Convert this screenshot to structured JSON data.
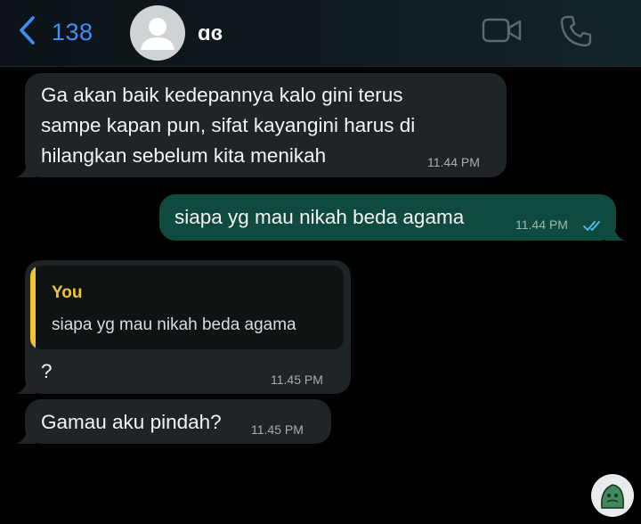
{
  "header": {
    "back_count": "138",
    "contact_name": "ɑɞ",
    "icons": [
      "chevron-left-icon",
      "video-icon",
      "phone-icon"
    ]
  },
  "messages": [
    {
      "direction": "incoming",
      "text": "Ga akan baik kedepannya kalo gini terus\nsampe kapan pun, sifat kayangini harus di\nhilangkan sebelum kita menikah",
      "time": "11.44 PM"
    },
    {
      "direction": "outgoing",
      "text": "siapa yg mau nikah beda agama",
      "time": "11.44 PM",
      "status": "read"
    },
    {
      "direction": "incoming",
      "quote": {
        "author": "You",
        "text": "siapa yg mau nikah beda agama"
      },
      "text": "?",
      "time": "11.45 PM"
    },
    {
      "direction": "incoming",
      "text": "Gamau aku pindah?",
      "time": "11.45 PM"
    }
  ],
  "colors": {
    "accent": "#3d8ff7",
    "incoming_bubble": "#1f2426",
    "outgoing_bubble": "#0f4a3e",
    "quote_bar": "#f1c232",
    "read_ticks": "#53bdeb"
  }
}
